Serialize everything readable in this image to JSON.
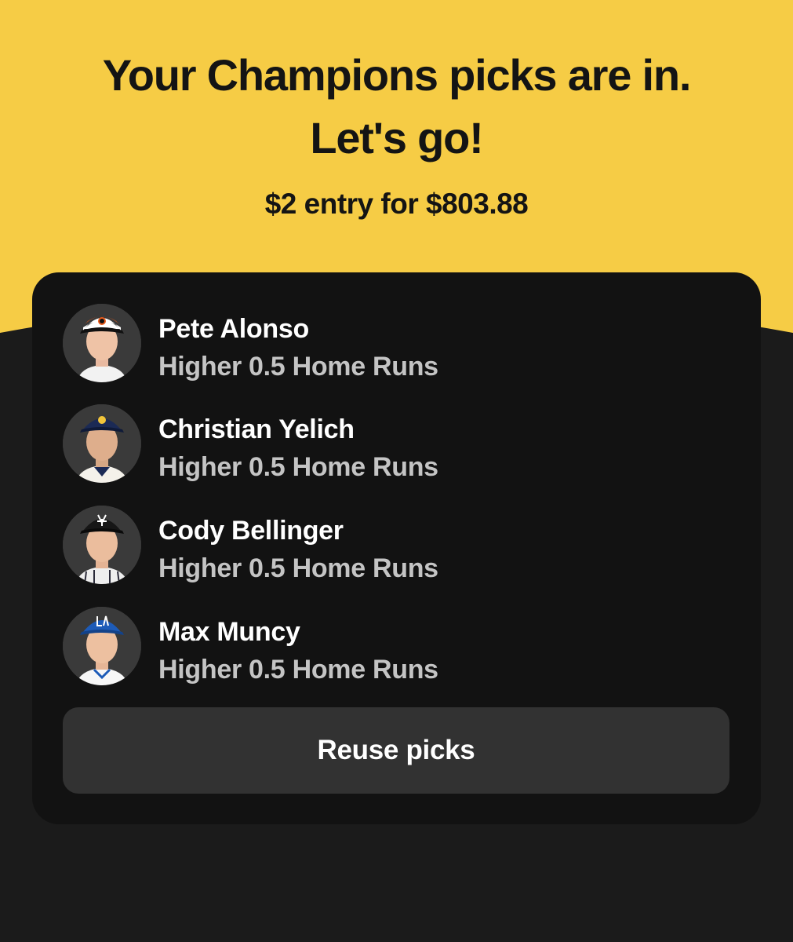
{
  "colors": {
    "hero_yellow": "#f6cc45",
    "page_dark": "#1b1b1b",
    "card_black": "#121212",
    "button_gray": "#323232",
    "secondary_text": "#c4c4c4"
  },
  "hero": {
    "headline_line1": "Your Champions picks are in.",
    "headline_line2": "Let's go!",
    "entry_text": "$2 entry for $803.88"
  },
  "picks": [
    {
      "player": "Pete Alonso",
      "direction": "Higher",
      "line": "0.5",
      "stat": "Home Runs",
      "avatar_icon": "player-headshot-orioles-cap"
    },
    {
      "player": "Christian Yelich",
      "direction": "Higher",
      "line": "0.5",
      "stat": "Home Runs",
      "avatar_icon": "player-headshot-brewers-cap"
    },
    {
      "player": "Cody Bellinger",
      "direction": "Higher",
      "line": "0.5",
      "stat": "Home Runs",
      "avatar_icon": "player-headshot-yankees-cap"
    },
    {
      "player": "Max Muncy",
      "direction": "Higher",
      "line": "0.5",
      "stat": "Home Runs",
      "avatar_icon": "player-headshot-dodgers-cap"
    }
  ],
  "actions": {
    "reuse_label": "Reuse picks"
  }
}
